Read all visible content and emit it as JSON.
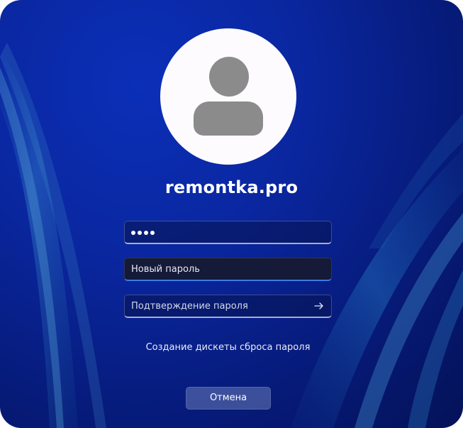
{
  "user": {
    "name": "remontka.pro"
  },
  "password_field": {
    "masked_length": 4,
    "dots": [
      "•",
      "•",
      "•",
      "•"
    ]
  },
  "new_password_field": {
    "placeholder": "Новый пароль"
  },
  "confirm_password_field": {
    "placeholder": "Подтверждение пароля",
    "submit_icon": "arrow-right-icon"
  },
  "links": {
    "reset_disk": "Создание дискеты сброса пароля"
  },
  "buttons": {
    "cancel": "Отмена"
  },
  "icons": {
    "avatar": "user-avatar-icon"
  },
  "colors": {
    "background": "#0a27a0",
    "accent_underline": "#3d7be8",
    "avatar_bg": "#fdfbfd",
    "avatar_figure": "#8a8b8a"
  }
}
